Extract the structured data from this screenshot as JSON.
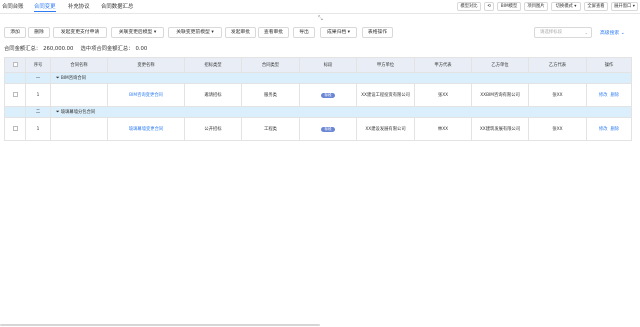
{
  "tabs": [
    "合同台账",
    "合同变更",
    "补充协议",
    "合同数据汇总"
  ],
  "top_buttons": [
    "模型对比",
    "⟲",
    "BIM模型",
    "项目图片",
    "切换模式 ▾",
    "全屏查看",
    "展开窗口 ▾"
  ],
  "toolbar": [
    "添加",
    "删除",
    "发起变更支付申请",
    "关联变更后模型 ▾",
    "关联变更前模型 ▾",
    "发起审批",
    "查看审批",
    "导出",
    "成果归档 ▾",
    "表格操作"
  ],
  "filter": {
    "placeholder": "请选择标段",
    "advanced_search": "高级搜索 ⌄"
  },
  "summary": {
    "total_label": "合同金额汇总：",
    "total_value": "260,000.00",
    "selected_label": "选中项合同金额汇总：",
    "selected_value": "0.00"
  },
  "columns": [
    "序号",
    "合同名称",
    "变更名称",
    "招标类型",
    "合同类型",
    "标段",
    "甲方单位",
    "甲方代表",
    "乙方单位",
    "乙方代表",
    "操作"
  ],
  "groups": [
    {
      "index": "一",
      "name": "BIM咨询合同",
      "rows": [
        {
          "no": "1",
          "contract_name": "",
          "change_name": "BIM咨询变更合同",
          "tender_type": "邀请招标",
          "contract_type": "服务类",
          "section": "标段",
          "party_a": "XX建设工程投资有限公司",
          "party_a_rep": "张XX",
          "party_b": "XXBIM咨询有限公司",
          "party_b_rep": "张XX"
        }
      ]
    },
    {
      "index": "二",
      "name": "玻璃幕墙分包合同",
      "rows": [
        {
          "no": "1",
          "contract_name": "",
          "change_name": "玻璃幕墙变更合同",
          "tender_type": "公开招标",
          "contract_type": "工程类",
          "section": "标段",
          "party_a": "XX建设发展有限公司",
          "party_a_rep": "林XX",
          "party_b": "XX建筑发展有限公司",
          "party_b_rep": "张XX"
        }
      ]
    }
  ],
  "ops": [
    "修改",
    "删除"
  ]
}
